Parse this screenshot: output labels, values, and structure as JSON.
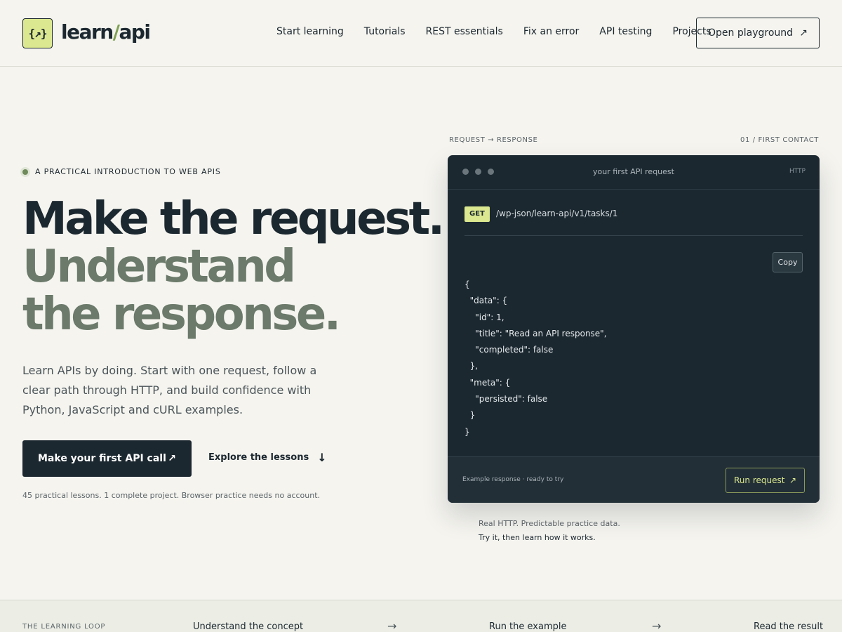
{
  "header": {
    "logo_glyph": "{↗}",
    "logo_text_a": "learn",
    "logo_text_slash": "/",
    "logo_text_b": "api",
    "nav": [
      "Start learning",
      "Tutorials",
      "REST essentials",
      "Fix an error",
      "API testing",
      "Projects"
    ],
    "cta_label": "Open playground",
    "cta_icon": "↗"
  },
  "hero": {
    "eyebrow": "A PRACTICAL INTRODUCTION TO WEB APIS",
    "headline_1": "Make the request.",
    "headline_2": "Understand",
    "headline_3": "the response.",
    "lead": "Learn APIs by doing. Start with one request, follow a clear path through HTTP, and build confidence with Python, JavaScript and cURL examples.",
    "primary_label": "Make your first API call",
    "primary_icon": "↗",
    "secondary_label": "Explore the lessons",
    "secondary_icon": "↓",
    "fineprint": "45 practical lessons. 1 complete project. Browser practice needs no account."
  },
  "card": {
    "label_left": "REQUEST → RESPONSE",
    "label_right": "01 / FIRST CONTACT",
    "title": "your first API request",
    "protocol": "HTTP",
    "method": "GET",
    "endpoint": "/wp-json/learn-api/v1/tasks/1",
    "copy_label": "Copy",
    "code": "{\n  \"data\": {\n    \"id\": 1,\n    \"title\": \"Read an API response\",\n    \"completed\": false\n  },\n  \"meta\": {\n    \"persisted\": false\n  }\n}",
    "status": "Example response · ready to try",
    "run_label": "Run request",
    "run_icon": "↗",
    "caption_1": "Real HTTP. Predictable practice data.",
    "caption_2": "Try it, then learn how it works."
  },
  "loop": {
    "label": "THE LEARNING LOOP",
    "step_1": "Understand the concept",
    "step_2": "Run the example",
    "step_3": "Read the result",
    "arrow": "→"
  },
  "colors": {
    "accent": "#dbe88f",
    "ink": "#1c2830",
    "muted_headline": "#6b7a6a",
    "background": "#f5f4ef"
  }
}
